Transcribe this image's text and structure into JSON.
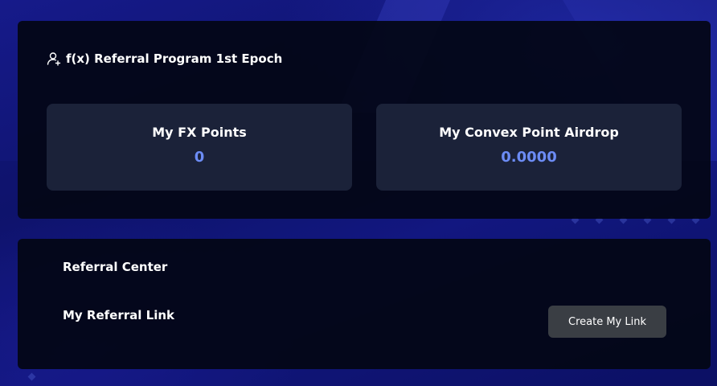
{
  "referral_program": {
    "title": "f(x) Referral Program 1st Epoch",
    "icon": "user-plus-icon",
    "stats": [
      {
        "label": "My FX Points",
        "value": "0"
      },
      {
        "label": "My Convex Point Airdrop",
        "value": "0.0000"
      }
    ]
  },
  "referral_center": {
    "title": "Referral Center",
    "link_label": "My Referral Link",
    "create_button": "Create My Link"
  },
  "colors": {
    "background": "#141a8c",
    "card": "#03060f",
    "stat_box": "#1b2239",
    "accent_value": "#6c8cf5",
    "button": "#3a3e44"
  }
}
